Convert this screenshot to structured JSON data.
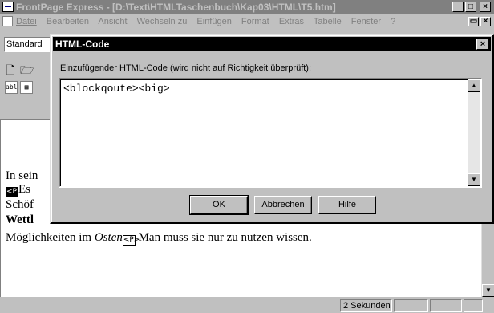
{
  "window": {
    "title": "FrontPage Express - [D:\\Text\\HTMLTaschenbuch\\Kap03\\HTML\\T5.htm]",
    "min_symbol": "_",
    "max_symbol": "□",
    "close_symbol": "×"
  },
  "menu": {
    "items": [
      "Datei",
      "Bearbeiten",
      "Ansicht",
      "Wechseln zu",
      "Einfügen",
      "Format",
      "Extras",
      "Tabelle",
      "Fenster",
      "?"
    ],
    "doc_min_symbol": "▭",
    "doc_close_symbol": "×"
  },
  "toolbar": {
    "style_combo_value": "Standard",
    "new_icon": "new-document-icon",
    "new_glyph": "🗋",
    "open_icon": "open-folder-icon",
    "open_glyph": "🗁",
    "form_field_glyph": "abl",
    "form_grid_glyph": "▦"
  },
  "editor": {
    "line1": "In sein",
    "line2_marker": "<P>",
    "line2": "Es",
    "line3": "Schöf",
    "line4": "Wettl",
    "line5_pre": "Möglichkeiten im ",
    "line5_em": "Osten",
    "line5_marker": "<P>",
    "line5_post": " Man muss sie nur zu nutzen wissen."
  },
  "dialog": {
    "title": "HTML-Code",
    "close_symbol": "×",
    "label": "Einzufügender HTML-Code (wird nicht auf Richtigkeit überprüft):",
    "code": "<blockqoute><big>",
    "ok_label": "OK",
    "cancel_label": "Abbrechen",
    "help_label": "Hilfe"
  },
  "statusbar": {
    "time": "2 Sekunden"
  },
  "scroll": {
    "up": "▲",
    "down": "▼"
  }
}
